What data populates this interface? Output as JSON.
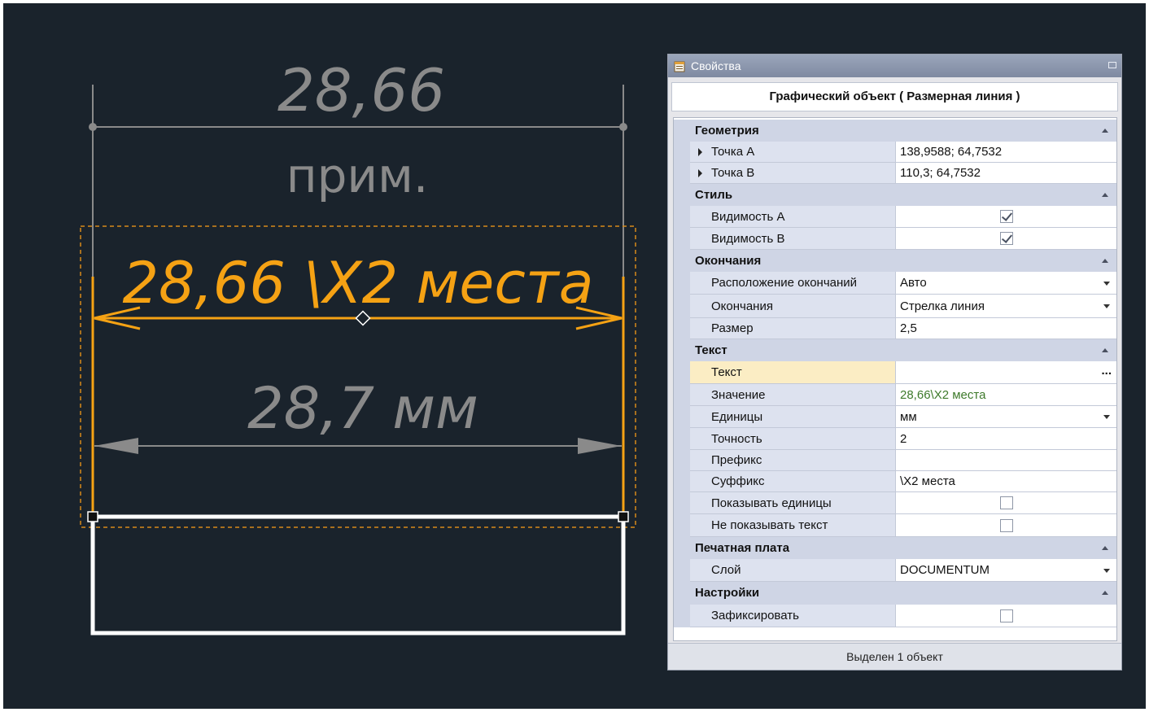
{
  "drawing": {
    "top_dim_text": "28,66",
    "top_dim_note": "прим.",
    "selected_dim_text": "28,66 \\X2 места",
    "lower_dim_text": "28,7 мм",
    "colors": {
      "background": "#1a232c",
      "dimension_gray": "#8a8a8a",
      "selected_orange": "#f5a214",
      "outline_white": "#ffffff"
    }
  },
  "panel": {
    "title": "Свойства",
    "object_title": "Графический объект ( Размерная линия )",
    "status": "Выделен 1 объект",
    "categories": {
      "geometry": "Геометрия",
      "style": "Стиль",
      "endings": "Окончания",
      "text": "Текст",
      "pcb": "Печатная плата",
      "settings": "Настройки"
    },
    "rows": {
      "point_a": {
        "label": "Точка A",
        "value": "138,9588; 64,7532"
      },
      "point_b": {
        "label": "Точка B",
        "value": "110,3; 64,7532"
      },
      "vis_a": {
        "label": "Видимость A",
        "checked": true
      },
      "vis_b": {
        "label": "Видимость B",
        "checked": true
      },
      "endings_position": {
        "label": "Расположение окончаний",
        "value": "Авто"
      },
      "endings": {
        "label": "Окончания",
        "value": "Стрелка линия"
      },
      "size": {
        "label": "Размер",
        "value": "2,5"
      },
      "text": {
        "label": "Текст",
        "value": "",
        "ellipsis": "..."
      },
      "value": {
        "label": "Значение",
        "value": "28,66\\X2 места"
      },
      "units": {
        "label": "Единицы",
        "value": "мм"
      },
      "precision": {
        "label": "Точность",
        "value": "2"
      },
      "prefix": {
        "label": "Префикс",
        "value": ""
      },
      "suffix": {
        "label": "Суффикс",
        "value": "\\X2 места"
      },
      "show_units": {
        "label": "Показывать единицы",
        "checked": false
      },
      "hide_text": {
        "label": "Не показывать текст",
        "checked": false
      },
      "layer": {
        "label": "Слой",
        "value": "DOCUMENTUM"
      },
      "lock": {
        "label": "Зафиксировать",
        "checked": false
      }
    }
  }
}
